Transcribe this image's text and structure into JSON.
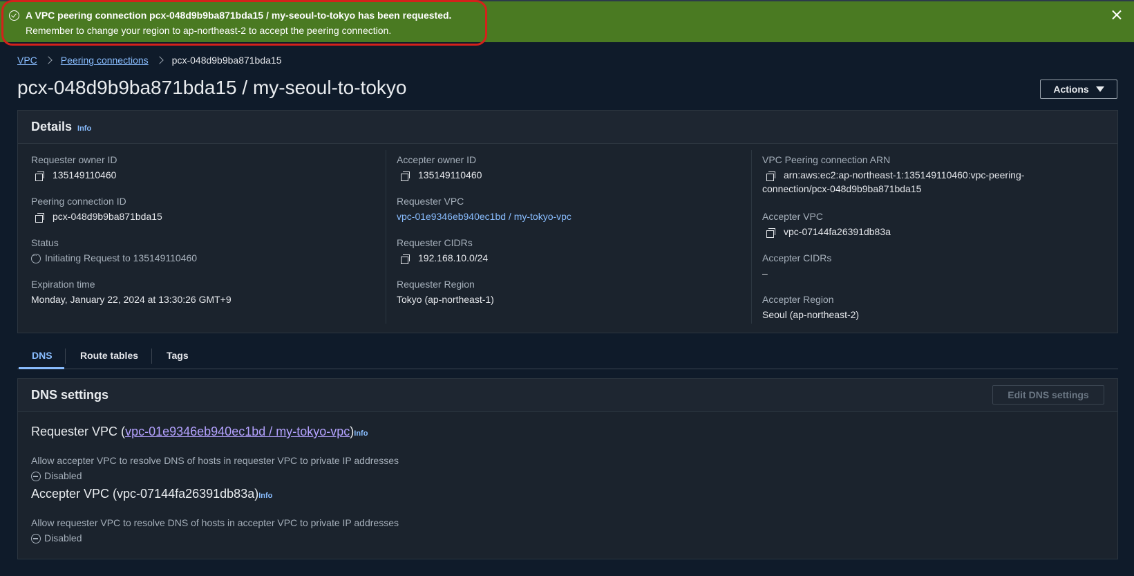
{
  "flash": {
    "line1": "A VPC peering connection pcx-048d9b9ba871bda15 / my-seoul-to-tokyo has been requested.",
    "line2": "Remember to change your region to ap-northeast-2 to accept the peering connection.",
    "color": "#4a7a22"
  },
  "breadcrumb": {
    "vpc": "VPC",
    "peering": "Peering connections",
    "current": "pcx-048d9b9ba871bda15"
  },
  "page_title": "pcx-048d9b9ba871bda15 / my-seoul-to-tokyo",
  "actions_label": "Actions",
  "details": {
    "title": "Details",
    "info": "Info",
    "requester_owner_label": "Requester owner ID",
    "requester_owner_value": "135149110460",
    "peering_id_label": "Peering connection ID",
    "peering_id_value": "pcx-048d9b9ba871bda15",
    "status_label": "Status",
    "status_value": "Initiating Request to 135149110460",
    "expiration_label": "Expiration time",
    "expiration_value": "Monday, January 22, 2024 at 13:30:26 GMT+9",
    "accepter_owner_label": "Accepter owner ID",
    "accepter_owner_value": "135149110460",
    "requester_vpc_label": "Requester VPC",
    "requester_vpc_value": "vpc-01e9346eb940ec1bd / my-tokyo-vpc",
    "requester_cidrs_label": "Requester CIDRs",
    "requester_cidrs_value": "192.168.10.0/24",
    "requester_region_label": "Requester Region",
    "requester_region_value": "Tokyo (ap-northeast-1)",
    "arn_label": "VPC Peering connection ARN",
    "arn_line1": "arn:aws:ec2:ap-northeast-1:135149110460:vpc-peering-",
    "arn_line2": "connection/pcx-048d9b9ba871bda15",
    "accepter_vpc_label": "Accepter VPC",
    "accepter_vpc_value": "vpc-07144fa26391db83a",
    "accepter_cidrs_label": "Accepter CIDRs",
    "accepter_cidrs_value": "–",
    "accepter_region_label": "Accepter Region",
    "accepter_region_value": "Seoul (ap-northeast-2)"
  },
  "tabs": [
    "DNS",
    "Route tables",
    "Tags"
  ],
  "dns": {
    "title": "DNS settings",
    "edit_label": "Edit DNS settings",
    "requester_prefix": "Requester VPC (",
    "requester_link": "vpc-01e9346eb940ec1bd / my-tokyo-vpc",
    "requester_suffix": ")",
    "requester_desc": "Allow accepter VPC to resolve DNS of hosts in requester VPC to private IP addresses",
    "requester_state": "Disabled",
    "accepter_heading": "Accepter VPC (vpc-07144fa26391db83a)",
    "accepter_desc": "Allow requester VPC to resolve DNS of hosts in accepter VPC to private IP addresses",
    "accepter_state": "Disabled",
    "info": "Info"
  }
}
